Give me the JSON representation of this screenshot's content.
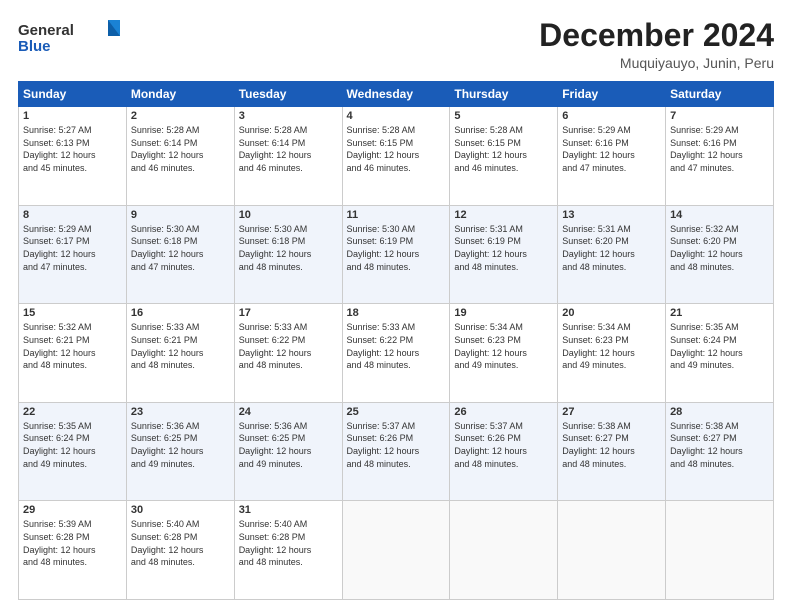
{
  "logo": {
    "line1": "General",
    "line2": "Blue"
  },
  "title": "December 2024",
  "subtitle": "Muquiyauyo, Junin, Peru",
  "days_of_week": [
    "Sunday",
    "Monday",
    "Tuesday",
    "Wednesday",
    "Thursday",
    "Friday",
    "Saturday"
  ],
  "weeks": [
    [
      {
        "day": "1",
        "info": "Sunrise: 5:27 AM\nSunset: 6:13 PM\nDaylight: 12 hours\nand 45 minutes."
      },
      {
        "day": "2",
        "info": "Sunrise: 5:28 AM\nSunset: 6:14 PM\nDaylight: 12 hours\nand 46 minutes."
      },
      {
        "day": "3",
        "info": "Sunrise: 5:28 AM\nSunset: 6:14 PM\nDaylight: 12 hours\nand 46 minutes."
      },
      {
        "day": "4",
        "info": "Sunrise: 5:28 AM\nSunset: 6:15 PM\nDaylight: 12 hours\nand 46 minutes."
      },
      {
        "day": "5",
        "info": "Sunrise: 5:28 AM\nSunset: 6:15 PM\nDaylight: 12 hours\nand 46 minutes."
      },
      {
        "day": "6",
        "info": "Sunrise: 5:29 AM\nSunset: 6:16 PM\nDaylight: 12 hours\nand 47 minutes."
      },
      {
        "day": "7",
        "info": "Sunrise: 5:29 AM\nSunset: 6:16 PM\nDaylight: 12 hours\nand 47 minutes."
      }
    ],
    [
      {
        "day": "8",
        "info": "Sunrise: 5:29 AM\nSunset: 6:17 PM\nDaylight: 12 hours\nand 47 minutes."
      },
      {
        "day": "9",
        "info": "Sunrise: 5:30 AM\nSunset: 6:18 PM\nDaylight: 12 hours\nand 47 minutes."
      },
      {
        "day": "10",
        "info": "Sunrise: 5:30 AM\nSunset: 6:18 PM\nDaylight: 12 hours\nand 48 minutes."
      },
      {
        "day": "11",
        "info": "Sunrise: 5:30 AM\nSunset: 6:19 PM\nDaylight: 12 hours\nand 48 minutes."
      },
      {
        "day": "12",
        "info": "Sunrise: 5:31 AM\nSunset: 6:19 PM\nDaylight: 12 hours\nand 48 minutes."
      },
      {
        "day": "13",
        "info": "Sunrise: 5:31 AM\nSunset: 6:20 PM\nDaylight: 12 hours\nand 48 minutes."
      },
      {
        "day": "14",
        "info": "Sunrise: 5:32 AM\nSunset: 6:20 PM\nDaylight: 12 hours\nand 48 minutes."
      }
    ],
    [
      {
        "day": "15",
        "info": "Sunrise: 5:32 AM\nSunset: 6:21 PM\nDaylight: 12 hours\nand 48 minutes."
      },
      {
        "day": "16",
        "info": "Sunrise: 5:33 AM\nSunset: 6:21 PM\nDaylight: 12 hours\nand 48 minutes."
      },
      {
        "day": "17",
        "info": "Sunrise: 5:33 AM\nSunset: 6:22 PM\nDaylight: 12 hours\nand 48 minutes."
      },
      {
        "day": "18",
        "info": "Sunrise: 5:33 AM\nSunset: 6:22 PM\nDaylight: 12 hours\nand 48 minutes."
      },
      {
        "day": "19",
        "info": "Sunrise: 5:34 AM\nSunset: 6:23 PM\nDaylight: 12 hours\nand 49 minutes."
      },
      {
        "day": "20",
        "info": "Sunrise: 5:34 AM\nSunset: 6:23 PM\nDaylight: 12 hours\nand 49 minutes."
      },
      {
        "day": "21",
        "info": "Sunrise: 5:35 AM\nSunset: 6:24 PM\nDaylight: 12 hours\nand 49 minutes."
      }
    ],
    [
      {
        "day": "22",
        "info": "Sunrise: 5:35 AM\nSunset: 6:24 PM\nDaylight: 12 hours\nand 49 minutes."
      },
      {
        "day": "23",
        "info": "Sunrise: 5:36 AM\nSunset: 6:25 PM\nDaylight: 12 hours\nand 49 minutes."
      },
      {
        "day": "24",
        "info": "Sunrise: 5:36 AM\nSunset: 6:25 PM\nDaylight: 12 hours\nand 49 minutes."
      },
      {
        "day": "25",
        "info": "Sunrise: 5:37 AM\nSunset: 6:26 PM\nDaylight: 12 hours\nand 48 minutes."
      },
      {
        "day": "26",
        "info": "Sunrise: 5:37 AM\nSunset: 6:26 PM\nDaylight: 12 hours\nand 48 minutes."
      },
      {
        "day": "27",
        "info": "Sunrise: 5:38 AM\nSunset: 6:27 PM\nDaylight: 12 hours\nand 48 minutes."
      },
      {
        "day": "28",
        "info": "Sunrise: 5:38 AM\nSunset: 6:27 PM\nDaylight: 12 hours\nand 48 minutes."
      }
    ],
    [
      {
        "day": "29",
        "info": "Sunrise: 5:39 AM\nSunset: 6:28 PM\nDaylight: 12 hours\nand 48 minutes."
      },
      {
        "day": "30",
        "info": "Sunrise: 5:40 AM\nSunset: 6:28 PM\nDaylight: 12 hours\nand 48 minutes."
      },
      {
        "day": "31",
        "info": "Sunrise: 5:40 AM\nSunset: 6:28 PM\nDaylight: 12 hours\nand 48 minutes."
      },
      {
        "day": "",
        "info": ""
      },
      {
        "day": "",
        "info": ""
      },
      {
        "day": "",
        "info": ""
      },
      {
        "day": "",
        "info": ""
      }
    ]
  ]
}
